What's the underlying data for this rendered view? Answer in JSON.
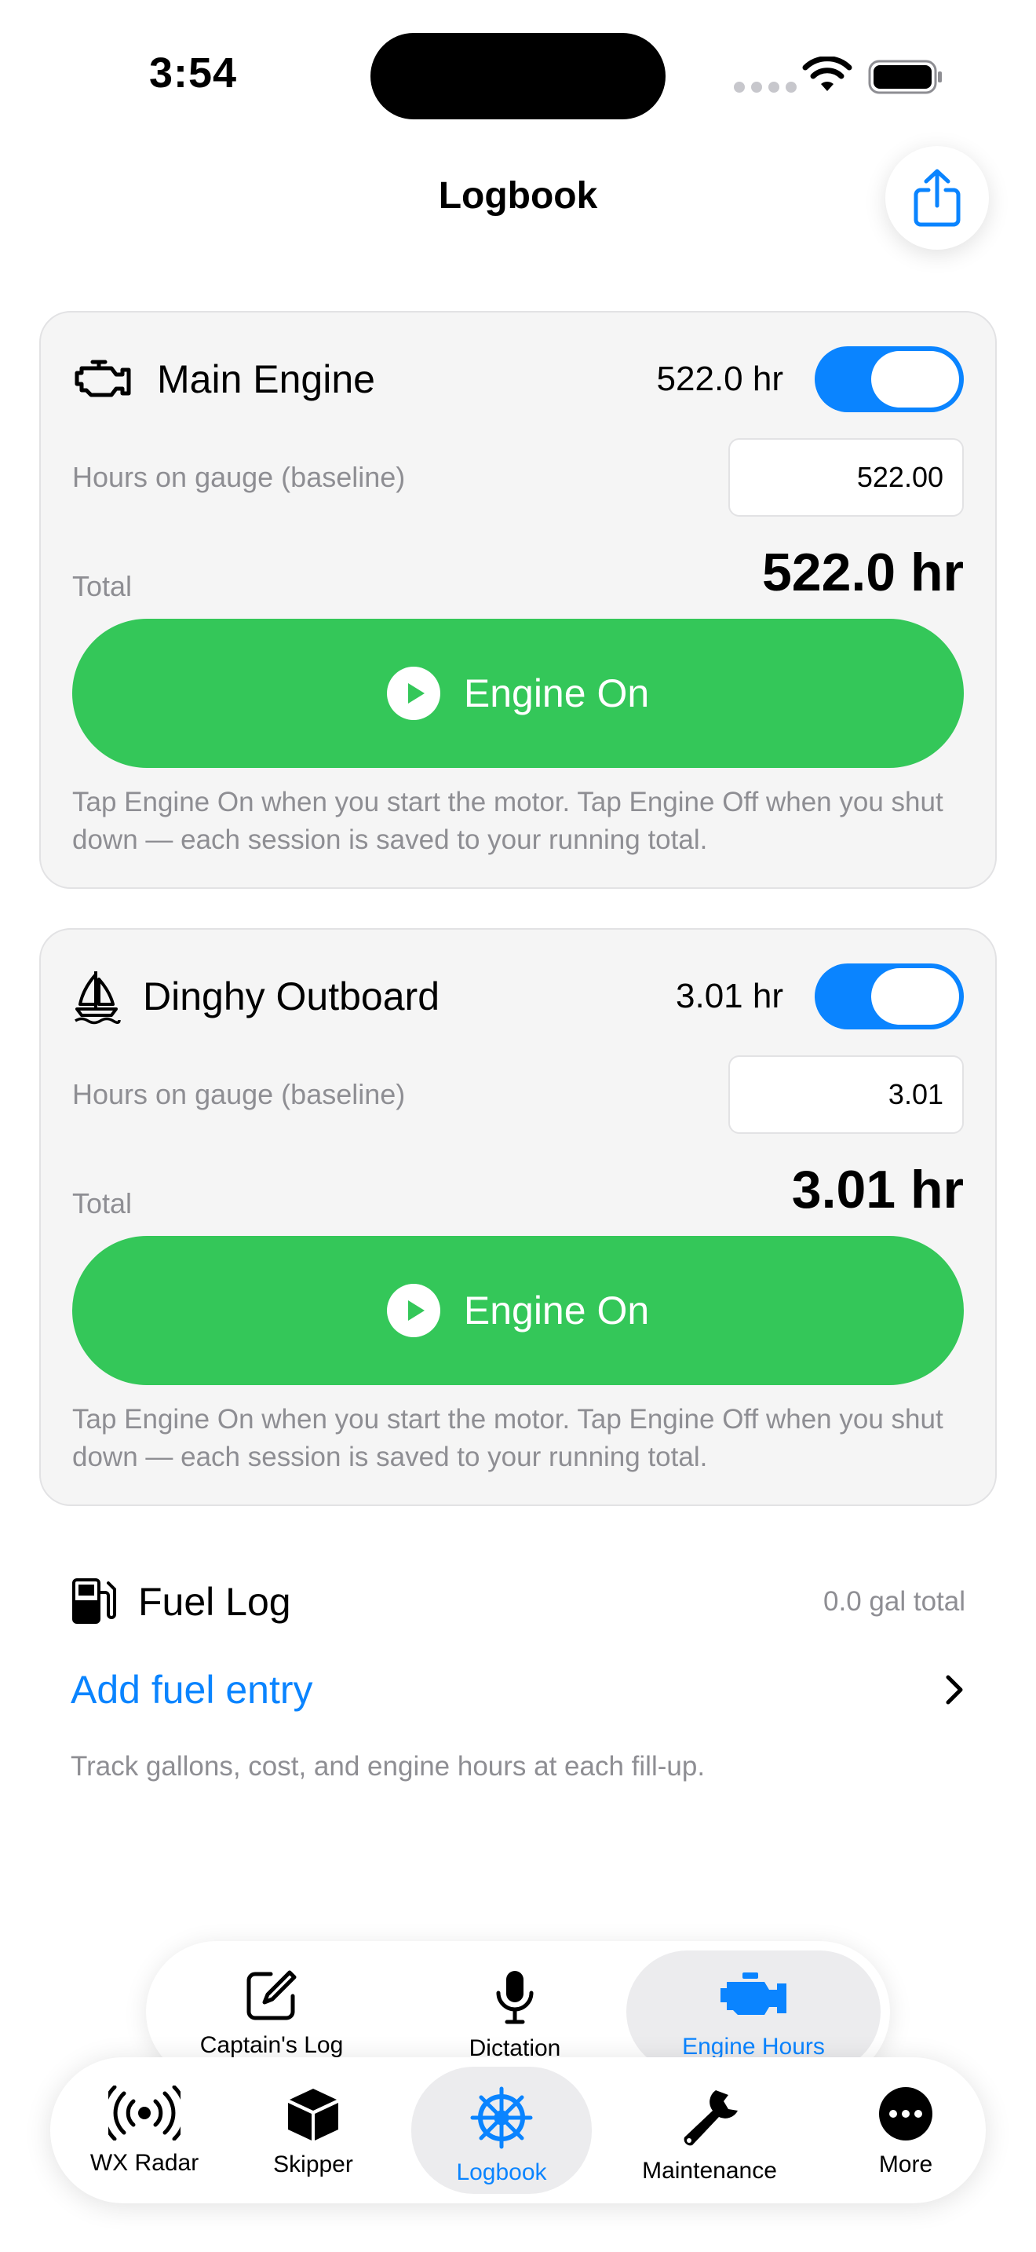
{
  "status_bar": {
    "time": "3:54"
  },
  "header": {
    "title": "Logbook",
    "share_icon": "share-icon"
  },
  "engines": [
    {
      "name": "Main Engine",
      "icon": "engine-icon",
      "hours": "522.0 hr",
      "toggle_on": true,
      "gauge_label": "Hours on gauge (baseline)",
      "gauge_value": "522.00",
      "total_label": "Total",
      "total_value": "522.0 hr",
      "button_label": "Engine On",
      "hint": "Tap Engine On when you start the motor. Tap Engine Off when you shut down — each session is saved to your running total."
    },
    {
      "name": "Dinghy Outboard",
      "icon": "sailboat-icon",
      "hours": "3.01 hr",
      "toggle_on": true,
      "gauge_label": "Hours on gauge (baseline)",
      "gauge_value": "3.01",
      "total_label": "Total",
      "total_value": "3.01 hr",
      "button_label": "Engine On",
      "hint": "Tap Engine On when you start the motor. Tap Engine Off when you shut down — each session is saved to your running total."
    }
  ],
  "fuel": {
    "title": "Fuel Log",
    "total": "0.0 gal total",
    "add_label": "Add fuel entry",
    "hint": "Track gallons, cost, and engine hours at each fill-up."
  },
  "subtabs": [
    {
      "label": "Captain's Log",
      "icon": "compose-icon"
    },
    {
      "label": "Dictation",
      "icon": "microphone-icon"
    },
    {
      "label": "Engine Hours",
      "icon": "engine-icon",
      "selected": true
    }
  ],
  "tabs": [
    {
      "label": "WX Radar",
      "icon": "radar-icon"
    },
    {
      "label": "Skipper",
      "icon": "cube-icon"
    },
    {
      "label": "Logbook",
      "icon": "helm-icon",
      "selected": true
    },
    {
      "label": "Maintenance",
      "icon": "wrench-icon"
    },
    {
      "label": "More",
      "icon": "more-icon"
    }
  ],
  "colors": {
    "accent": "#0a84ff",
    "engine_button": "#34c759",
    "card_bg": "#f5f5f5",
    "muted_text": "#8e8e93"
  }
}
